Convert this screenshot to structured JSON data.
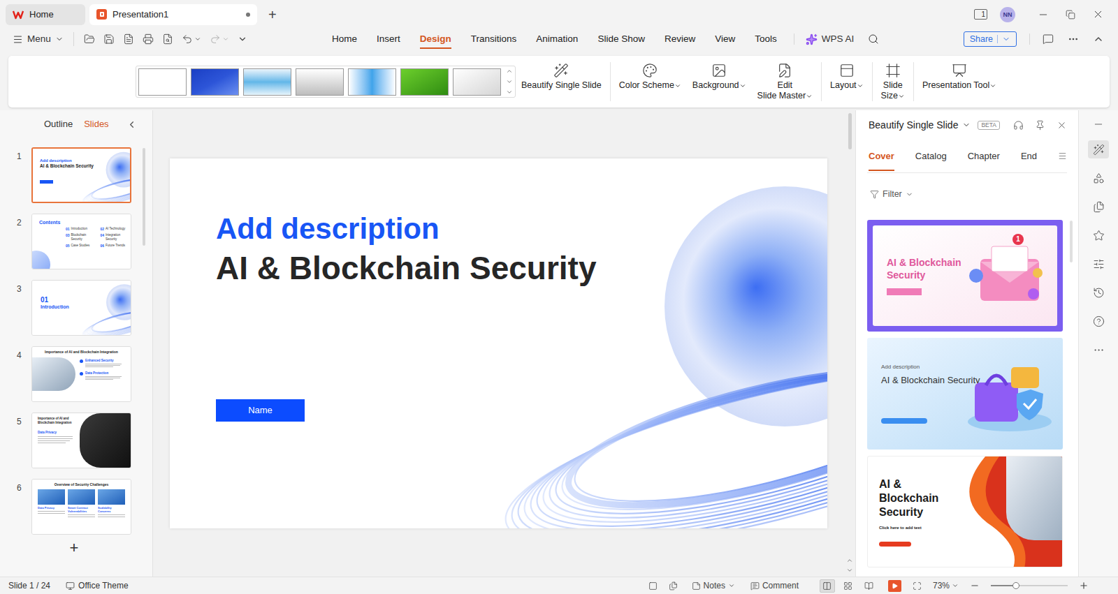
{
  "titlebar": {
    "tabs": [
      {
        "label": "Home",
        "kind": "home",
        "selected": false,
        "unsaved": false
      },
      {
        "label": "Presentation1",
        "kind": "doc",
        "selected": true,
        "unsaved": true
      }
    ],
    "new_tab": "+",
    "window_count": "1",
    "avatar": "NN"
  },
  "menubar": {
    "menu": "Menu",
    "tabs": [
      {
        "label": "Home",
        "selected": false
      },
      {
        "label": "Insert",
        "selected": false
      },
      {
        "label": "Design",
        "selected": true
      },
      {
        "label": "Transitions",
        "selected": false
      },
      {
        "label": "Animation",
        "selected": false
      },
      {
        "label": "Slide Show",
        "selected": false
      },
      {
        "label": "Review",
        "selected": false
      },
      {
        "label": "View",
        "selected": false
      },
      {
        "label": "Tools",
        "selected": false
      }
    ],
    "ai": "WPS AI",
    "share": "Share"
  },
  "ribbon": {
    "groups": [
      [
        {
          "lines": [
            "Beautify Single Slide"
          ],
          "dropdown": false
        }
      ],
      [
        {
          "lines": [
            "Color Scheme"
          ],
          "dropdown": true
        },
        {
          "lines": [
            "Background"
          ],
          "dropdown": true
        },
        {
          "lines": [
            "Edit",
            "Slide Master"
          ],
          "dropdown": true
        }
      ],
      [
        {
          "lines": [
            "Layout"
          ],
          "dropdown": true
        }
      ],
      [
        {
          "lines": [
            "Slide",
            "Size"
          ],
          "dropdown": true
        }
      ],
      [
        {
          "lines": [
            "Presentation Tool"
          ],
          "dropdown": true
        }
      ]
    ]
  },
  "slides_panel": {
    "tabs": [
      {
        "label": "Outline",
        "selected": false
      },
      {
        "label": "Slides",
        "selected": true
      }
    ],
    "slides": [
      {
        "number": "1",
        "selected": true,
        "kind": "cover",
        "title": "AI & Blockchain Security",
        "subtitle": "Add description",
        "items": []
      },
      {
        "number": "2",
        "selected": false,
        "kind": "contents",
        "title": "Contents",
        "subtitle": "",
        "items": [
          {
            "n": "01",
            "label": "Introduction"
          },
          {
            "n": "02",
            "label": "AI Technology"
          },
          {
            "n": "03",
            "label": "Blockchain Security"
          },
          {
            "n": "04",
            "label": "Integration Security"
          },
          {
            "n": "05",
            "label": "Case Studies"
          },
          {
            "n": "06",
            "label": "Future Trends"
          }
        ]
      },
      {
        "number": "3",
        "selected": false,
        "kind": "chapter",
        "title": "Introduction",
        "subtitle": "01",
        "items": []
      },
      {
        "number": "4",
        "selected": false,
        "kind": "image-left",
        "title": "Importance of AI and Blockchain Integration",
        "subtitle": "",
        "items": [
          {
            "n": "",
            "label": "Enhanced Security"
          },
          {
            "n": "",
            "label": "Data Protection"
          }
        ]
      },
      {
        "number": "5",
        "selected": false,
        "kind": "image-right",
        "title": "Importance of AI and Blockchain Integration",
        "subtitle": "",
        "items": [
          {
            "n": "",
            "label": "Data Privacy"
          }
        ]
      },
      {
        "number": "6",
        "selected": false,
        "kind": "three-column",
        "title": "Overview of Security Challenges",
        "subtitle": "",
        "items": [
          {
            "n": "",
            "label": "Data Privacy"
          },
          {
            "n": "",
            "label": "Smart Contract Vulnerabilities"
          },
          {
            "n": "",
            "label": "Scalability Concerns"
          }
        ]
      }
    ],
    "add": "+"
  },
  "slide": {
    "subtitle": "Add description",
    "title": "AI & Blockchain Security",
    "button": "Name"
  },
  "side_panel": {
    "title": "Beautify Single Slide",
    "badge": "BETA",
    "tabs": [
      {
        "label": "Cover",
        "selected": true
      },
      {
        "label": "Catalog",
        "selected": false
      },
      {
        "label": "Chapter",
        "selected": false
      },
      {
        "label": "End",
        "selected": false
      }
    ],
    "filter": "Filter",
    "cards": [
      {
        "kind": "purple",
        "title": "AI & Blockchain Security",
        "subtitle": "",
        "badge": "1"
      },
      {
        "kind": "light-blue",
        "title": "AI & Blockchain Security",
        "subtitle": "Add description",
        "badge": ""
      },
      {
        "kind": "orange",
        "title": "AI & Blockchain Security",
        "subtitle": "Click here to add text",
        "badge": ""
      }
    ]
  },
  "status_bar": {
    "slide": "Slide 1 / 24",
    "theme": "Office Theme",
    "notes": "Notes",
    "comment": "Comment",
    "zoom": "73%",
    "zoom_level": 0.33,
    "views": [
      {
        "selected": true
      },
      {
        "selected": false
      },
      {
        "selected": false
      }
    ]
  }
}
